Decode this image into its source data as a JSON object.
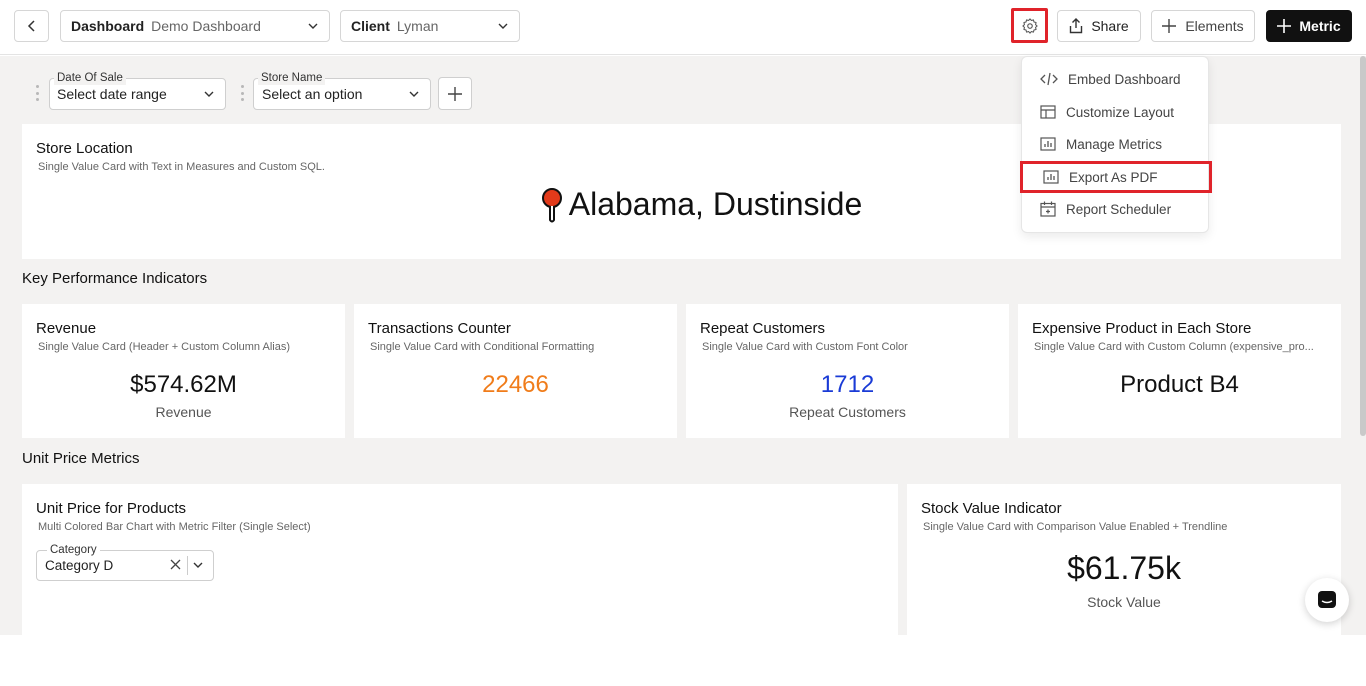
{
  "header": {
    "dashboard_label": "Dashboard",
    "dashboard_value": "Demo Dashboard",
    "client_label": "Client",
    "client_value": "Lyman",
    "share_label": "Share",
    "elements_label": "Elements",
    "metric_label": "Metric"
  },
  "filters": [
    {
      "label": "Date Of Sale",
      "value": "Select date range"
    },
    {
      "label": "Store Name",
      "value": "Select an option"
    }
  ],
  "store_location": {
    "title": "Store Location",
    "subtitle": "Single Value Card with Text in Measures and Custom SQL.",
    "value": "Alabama, Dustinside"
  },
  "kpi_section": {
    "title": "Key Performance Indicators"
  },
  "kpis": [
    {
      "title": "Revenue",
      "subtitle": "Single Value Card (Header + Custom Column Alias)",
      "value": "$574.62M",
      "caption": "Revenue",
      "color": "#111111"
    },
    {
      "title": "Transactions Counter",
      "subtitle": "Single Value Card with Conditional Formatting",
      "value": "22466",
      "caption": "",
      "color": "#f07c1a"
    },
    {
      "title": "Repeat Customers",
      "subtitle": "Single Value Card with Custom Font Color",
      "value": "1712",
      "caption": "Repeat Customers",
      "color": "#1a3bd6"
    },
    {
      "title": "Expensive Product in Each Store",
      "subtitle": "Single Value Card with Custom Column (expensive_pro...",
      "value": "Product B4",
      "caption": "",
      "color": "#111111"
    }
  ],
  "unit_section": {
    "title": "Unit Price Metrics"
  },
  "unit_price": {
    "title": "Unit Price for Products",
    "subtitle": "Multi Colored Bar Chart with Metric Filter (Single Select)",
    "filter_label": "Category",
    "filter_value": "Category D"
  },
  "stock": {
    "title": "Stock Value Indicator",
    "subtitle": "Single Value Card with Comparison Value Enabled + Trendline",
    "value": "$61.75k",
    "caption": "Stock Value"
  },
  "settings_menu": {
    "items": [
      {
        "label": "Embed Dashboard",
        "icon": "code-icon"
      },
      {
        "label": "Customize Layout",
        "icon": "layout-icon"
      },
      {
        "label": "Manage Metrics",
        "icon": "bar-chart-icon"
      },
      {
        "label": "Export As PDF",
        "icon": "bar-chart-icon"
      },
      {
        "label": "Report Scheduler",
        "icon": "calendar-icon"
      }
    ]
  },
  "colors": {
    "highlight": "#e0232a",
    "accent_orange": "#f07c1a",
    "accent_blue": "#1a3bd6"
  }
}
